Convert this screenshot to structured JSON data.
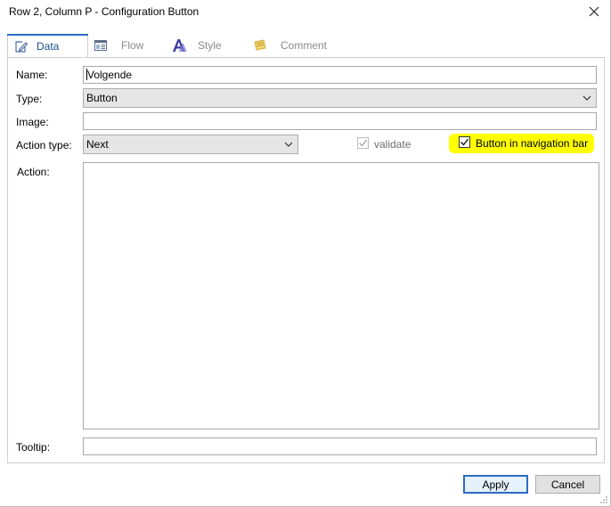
{
  "window": {
    "title": "Row 2, Column P - Configuration Button"
  },
  "tabs": [
    {
      "label": "Data",
      "icon": "edit-data-icon",
      "active": true
    },
    {
      "label": "Flow",
      "icon": "flow-window-icon",
      "active": false
    },
    {
      "label": "Style",
      "icon": "style-font-icon",
      "active": false
    },
    {
      "label": "Comment",
      "icon": "comment-note-icon",
      "active": false
    }
  ],
  "form": {
    "name_label": "Name:",
    "name_value": "Volgende",
    "type_label": "Type:",
    "type_value": "Button",
    "image_label": "Image:",
    "image_value": "",
    "action_type_label": "Action type:",
    "action_type_value": "Next",
    "validate_label": "validate",
    "validate_checked": true,
    "validate_disabled": true,
    "nav_bar_label": "Button in navigation bar",
    "nav_bar_checked": true,
    "action_label": "Action:",
    "action_value": "",
    "tooltip_label": "Tooltip:",
    "tooltip_value": ""
  },
  "buttons": {
    "apply": "Apply",
    "cancel": "Cancel"
  },
  "colors": {
    "highlight": "#ffff00",
    "accent": "#2a6cc4"
  }
}
